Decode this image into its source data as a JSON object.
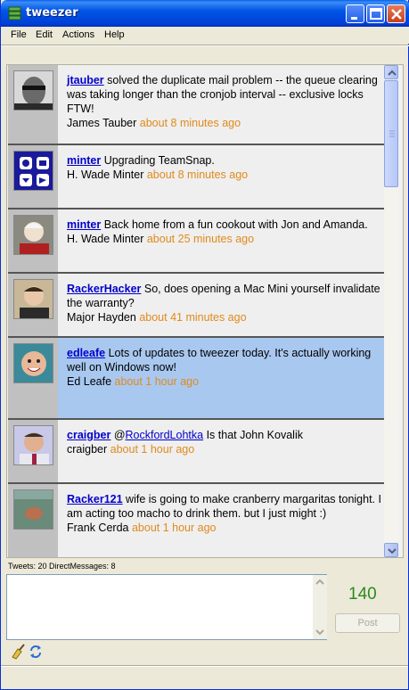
{
  "window": {
    "title": "tweezer"
  },
  "menu": [
    "File",
    "Edit",
    "Actions",
    "Help"
  ],
  "tweets": [
    {
      "user": "jtauber",
      "text": "solved the duplicate mail problem -- the queue clearing was taking longer than the cronjob interval -- exclusive locks FTW!",
      "name": "James Tauber",
      "time": "about 8 minutes ago"
    },
    {
      "user": "minter",
      "text": "Upgrading TeamSnap.",
      "name": "H. Wade Minter",
      "time": "about 8 minutes ago"
    },
    {
      "user": "minter",
      "text": "Back home from a fun cookout with Jon and Amanda.",
      "name": "H. Wade Minter",
      "time": "about 25 minutes ago"
    },
    {
      "user": "RackerHacker",
      "text": "So, does opening a Mac Mini yourself invalidate the warranty?",
      "name": "Major Hayden",
      "time": "about 41 minutes ago"
    },
    {
      "user": "edleafe",
      "text": "Lots of updates to tweezer today. It's actually working well on Windows now!",
      "name": "Ed Leafe",
      "time": "about 1 hour ago"
    },
    {
      "user": "craigber",
      "text_prefix": "@",
      "mention": "RockfordLohtka",
      "text": "Is that John Kovalik",
      "name": "craigber",
      "time": "about 1 hour ago"
    },
    {
      "user": "Racker121",
      "text": "wife is going to make cranberry margaritas tonight. I am acting too macho to drink them. but I just might :)",
      "name": "Frank Cerda",
      "time": "about 1 hour ago"
    }
  ],
  "status": {
    "text": "Tweets: 20  DirectMessages: 8"
  },
  "composer": {
    "placeholder": "",
    "value": ""
  },
  "counter": "140",
  "post_label": "Post",
  "colors": {
    "link": "#0000cc",
    "time": "#e08a1c",
    "highlight": "#a9c8f0",
    "counter": "#2a8a20"
  }
}
